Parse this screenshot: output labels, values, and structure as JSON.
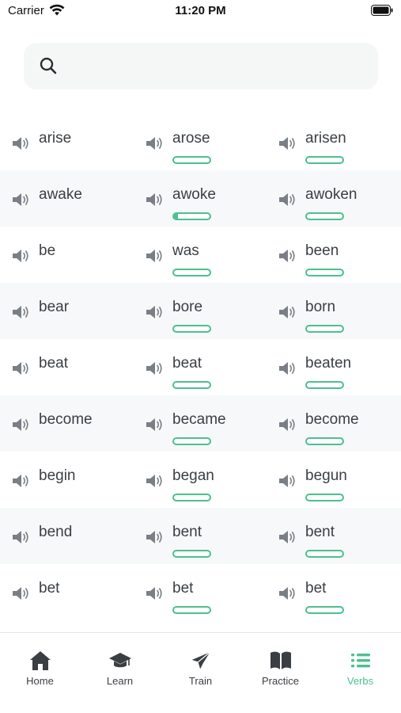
{
  "status_bar": {
    "carrier": "Carrier",
    "time": "11:20 PM"
  },
  "search": {
    "placeholder": "",
    "value": ""
  },
  "colors": {
    "accent": "#4cc08f",
    "text": "#3b3f44",
    "row_alt": "#f6f8f9"
  },
  "verbs": [
    {
      "base": "arise",
      "past": "arose",
      "participle": "arisen",
      "past_progress": 0,
      "participle_progress": 0,
      "show_progress": true
    },
    {
      "base": "awake",
      "past": "awoke",
      "participle": "awoken",
      "past_progress": 0.12,
      "participle_progress": 0,
      "show_progress": true
    },
    {
      "base": "be",
      "past": "was",
      "participle": "been",
      "past_progress": 0,
      "participle_progress": 0,
      "show_progress": true
    },
    {
      "base": "bear",
      "past": "bore",
      "participle": "born",
      "past_progress": 0,
      "participle_progress": 0,
      "show_progress": true
    },
    {
      "base": "beat",
      "past": "beat",
      "participle": "beaten",
      "past_progress": 0,
      "participle_progress": 0,
      "show_progress": true
    },
    {
      "base": "become",
      "past": "became",
      "participle": "become",
      "past_progress": 0,
      "participle_progress": 0,
      "show_progress": true
    },
    {
      "base": "begin",
      "past": "began",
      "participle": "begun",
      "past_progress": 0,
      "participle_progress": 0,
      "show_progress": true
    },
    {
      "base": "bend",
      "past": "bent",
      "participle": "bent",
      "past_progress": 0,
      "participle_progress": 0,
      "show_progress": true
    },
    {
      "base": "bet",
      "past": "bet",
      "participle": "bet",
      "past_progress": 0,
      "participle_progress": 0,
      "show_progress": true
    }
  ],
  "tabs": [
    {
      "label": "Home",
      "icon": "home-icon",
      "active": false
    },
    {
      "label": "Learn",
      "icon": "graduation-cap-icon",
      "active": false
    },
    {
      "label": "Train",
      "icon": "paper-plane-icon",
      "active": false
    },
    {
      "label": "Practice",
      "icon": "book-icon",
      "active": false
    },
    {
      "label": "Verbs",
      "icon": "list-icon",
      "active": true
    }
  ]
}
